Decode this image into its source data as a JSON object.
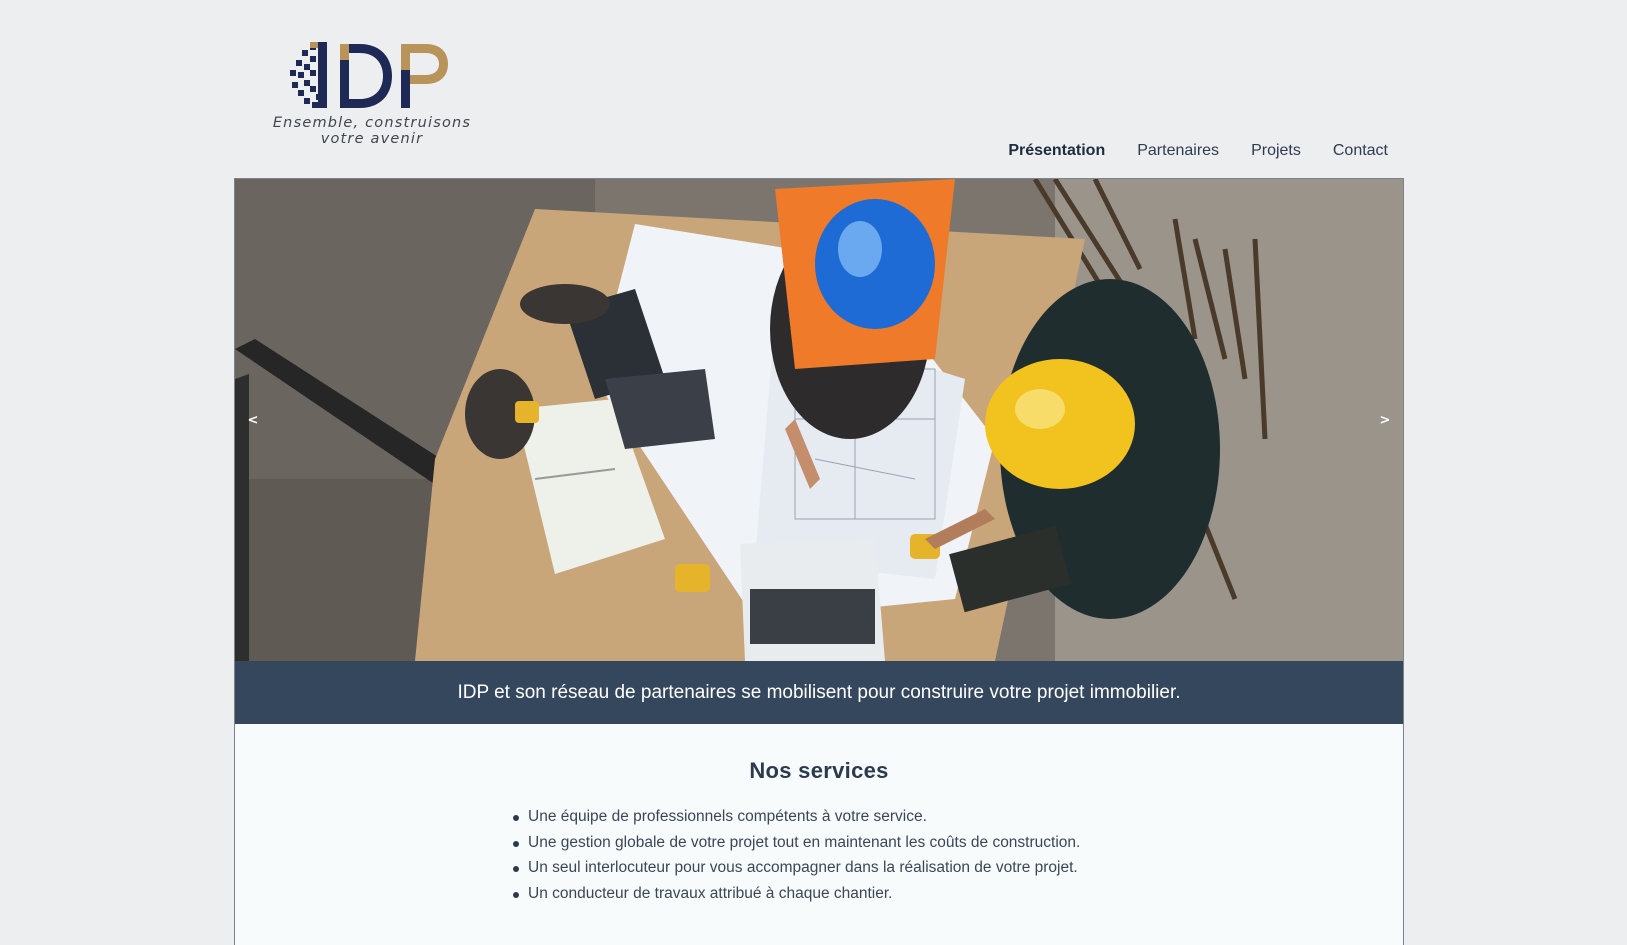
{
  "brand": {
    "logo_text": "IDP",
    "tagline_line1": "Ensemble, construisons",
    "tagline_line2": "votre avenir",
    "colors": {
      "navy": "#1e2a55",
      "gold": "#b8935a"
    }
  },
  "nav": {
    "items": [
      {
        "label": "Présentation",
        "active": true
      },
      {
        "label": "Partenaires",
        "active": false
      },
      {
        "label": "Projets",
        "active": false
      },
      {
        "label": "Contact",
        "active": false
      }
    ]
  },
  "hero": {
    "image": "construction-workers-reviewing-blueprints",
    "prev_label": "<",
    "next_label": ">"
  },
  "banner": {
    "text": "IDP et son réseau de partenaires se mobilisent pour construire votre projet immobilier.",
    "color": "#34475d"
  },
  "services": {
    "title": "Nos services",
    "items": [
      "Une équipe de professionnels compétents à votre service.",
      "Une gestion globale de votre projet tout en maintenant les coûts de construction.",
      "Un seul interlocuteur pour vous accompagner dans la réalisation de votre projet.",
      "Un conducteur de travaux attribué à chaque chantier."
    ]
  }
}
